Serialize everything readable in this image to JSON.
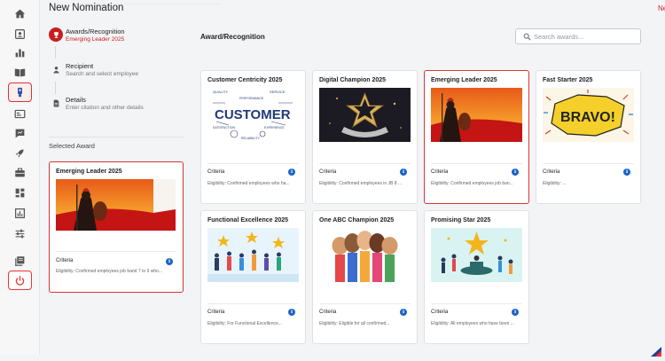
{
  "header": {
    "title": "New Nomination",
    "next_label": "Next",
    "next_arrow": "›"
  },
  "nav": {
    "items": [
      {
        "icon": "home-icon"
      },
      {
        "icon": "profile-card-icon"
      },
      {
        "icon": "bar-chart-icon"
      },
      {
        "icon": "book-icon"
      },
      {
        "icon": "award-badge-icon",
        "active": true
      },
      {
        "icon": "id-card-icon"
      },
      {
        "icon": "chat-icon"
      },
      {
        "icon": "rocket-icon"
      },
      {
        "icon": "briefcase-icon"
      },
      {
        "icon": "dashboard-icon"
      },
      {
        "icon": "report-icon"
      },
      {
        "icon": "sliders-icon"
      },
      {
        "icon": "library-icon"
      },
      {
        "icon": "power-icon"
      }
    ]
  },
  "steps": [
    {
      "title": "Awards/Recognition",
      "subtitle": "Emerging Leader 2025",
      "active": true,
      "icon": "trophy-icon"
    },
    {
      "title": "Recipient",
      "subtitle": "Search and select employee",
      "active": false,
      "icon": "person-icon"
    },
    {
      "title": "Details",
      "subtitle": "Enter citation and other details",
      "active": false,
      "icon": "document-icon"
    }
  ],
  "selected_award": {
    "label": "Selected Award",
    "title": "Emerging Leader 2025",
    "criteria_label": "Criteria",
    "eligibility": "Eligibility: Confirmed employees job band 7 to 9 who..."
  },
  "awards_section": {
    "title": "Award/Recognition",
    "search_placeholder": "Search awards..."
  },
  "awards": [
    {
      "title": "Customer Centricity 2025",
      "criteria_label": "Criteria",
      "eligibility": "Eligibility: Confirmed employees who ha...",
      "selected": false
    },
    {
      "title": "Digital Champion 2025",
      "criteria_label": "Criteria",
      "eligibility": "Eligibility: Confirmed employees in JB 8 ...",
      "selected": false
    },
    {
      "title": "Emerging Leader 2025",
      "criteria_label": "Criteria",
      "eligibility": "Eligibility: Confirmed employees job ban...",
      "selected": true
    },
    {
      "title": "Fast Starter 2025",
      "criteria_label": "Criteria",
      "eligibility": "Eligibility: ...",
      "selected": false
    },
    {
      "title": "Functional Excellence 2025",
      "criteria_label": "Criteria",
      "eligibility": "Eligibility: For Functional Excellence...",
      "selected": false
    },
    {
      "title": "One ABC Champion 2025",
      "criteria_label": "Criteria",
      "eligibility": "Eligibility: Eligible for all confirmed...",
      "selected": false
    },
    {
      "title": "Promising Star 2025",
      "criteria_label": "Criteria",
      "eligibility": "Eligibility: All employees who have been ...",
      "selected": false
    }
  ],
  "image_text": {
    "customer_words": [
      "QUALITY",
      "SERVICE",
      "PERFORMANCE",
      "CUSTOMER",
      "SATISFACTION",
      "EXPERIENCE",
      "RELIABILITY"
    ],
    "bravo": "BRAVO!"
  },
  "colors": {
    "accent": "#c81e1e",
    "info": "#1e63c8"
  }
}
